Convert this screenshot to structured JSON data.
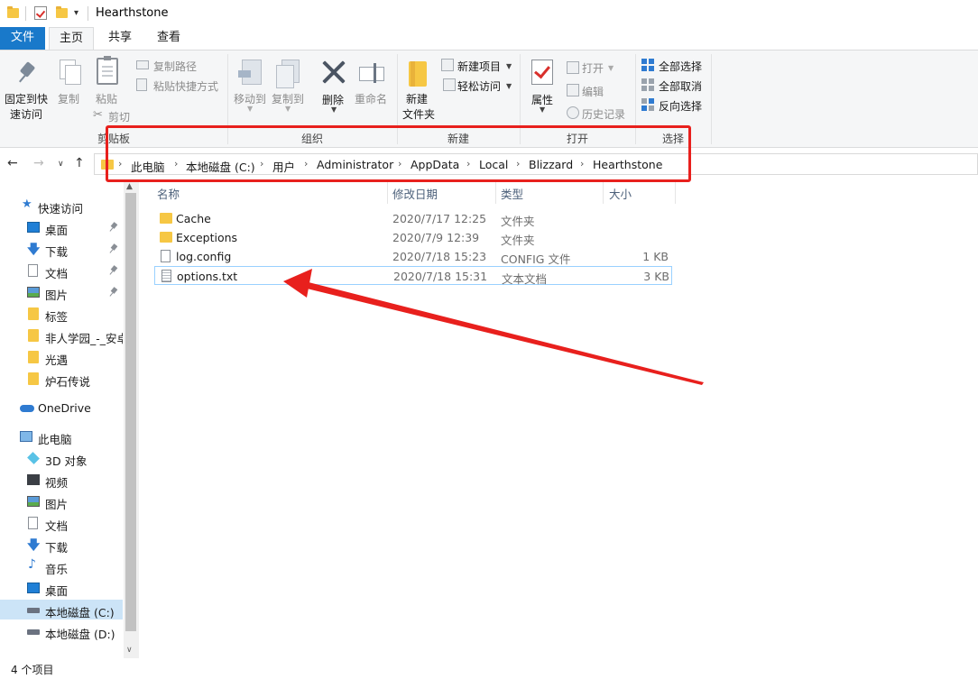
{
  "window": {
    "title": "Hearthstone"
  },
  "ribbon_tabs": {
    "file": "文件",
    "home": "主页",
    "share": "共享",
    "view": "查看"
  },
  "ribbon": {
    "clipboard": {
      "pin_line1": "固定到快",
      "pin_line2": "速访问",
      "copy": "复制",
      "paste": "粘贴",
      "copy_path": "复制路径",
      "paste_shortcut": "粘贴快捷方式",
      "cut": "剪切",
      "group_label": "剪贴板"
    },
    "organize": {
      "move_to": "移动到",
      "copy_to": "复制到",
      "delete": "删除",
      "rename": "重命名",
      "group_label": "组织"
    },
    "new": {
      "new_item": "新建项目",
      "easy_access": "轻松访问",
      "new_folder_line1": "新建",
      "new_folder_line2": "文件夹",
      "group_label": "新建"
    },
    "open": {
      "properties": "属性",
      "open": "打开",
      "edit": "编辑",
      "history": "历史记录",
      "group_label": "打开"
    },
    "select": {
      "select_all": "全部选择",
      "select_none": "全部取消",
      "invert": "反向选择",
      "group_label": "选择"
    }
  },
  "breadcrumb": [
    "此电脑",
    "本地磁盘 (C:)",
    "用户",
    "Administrator",
    "AppData",
    "Local",
    "Blizzard",
    "Hearthstone"
  ],
  "sidebar": {
    "quick_access": "快速访问",
    "items": [
      {
        "label": "桌面",
        "icon": "desktop-icon",
        "pinned": true
      },
      {
        "label": "下载",
        "icon": "download-icon",
        "pinned": true
      },
      {
        "label": "文档",
        "icon": "document-icon",
        "pinned": true
      },
      {
        "label": "图片",
        "icon": "picture-icon",
        "pinned": true
      },
      {
        "label": "标签",
        "icon": "folder-icon",
        "pinned": false
      },
      {
        "label": "非人学园_-_安卓",
        "icon": "folder-icon",
        "pinned": false
      },
      {
        "label": "光遇",
        "icon": "folder-icon",
        "pinned": false
      },
      {
        "label": "炉石传说",
        "icon": "folder-icon",
        "pinned": false
      }
    ],
    "onedrive": "OneDrive",
    "this_pc": "此电脑",
    "pc_items": [
      {
        "label": "3D 对象",
        "icon": "3d-objects-icon"
      },
      {
        "label": "视频",
        "icon": "video-icon"
      },
      {
        "label": "图片",
        "icon": "picture-icon"
      },
      {
        "label": "文档",
        "icon": "document-icon"
      },
      {
        "label": "下载",
        "icon": "download-icon"
      },
      {
        "label": "音乐",
        "icon": "music-icon"
      },
      {
        "label": "桌面",
        "icon": "desktop-icon"
      },
      {
        "label": "本地磁盘 (C:)",
        "icon": "drive-icon",
        "selected": true
      },
      {
        "label": "本地磁盘 (D:)",
        "icon": "drive-icon"
      }
    ]
  },
  "columns": {
    "name": "名称",
    "date": "修改日期",
    "type": "类型",
    "size": "大小"
  },
  "files": [
    {
      "name": "Cache",
      "date": "2020/7/17 12:25",
      "type": "文件夹",
      "size": "",
      "icon": "folder-icon"
    },
    {
      "name": "Exceptions",
      "date": "2020/7/9 12:39",
      "type": "文件夹",
      "size": "",
      "icon": "folder-icon"
    },
    {
      "name": "log.config",
      "date": "2020/7/18 15:23",
      "type": "CONFIG 文件",
      "size": "1 KB",
      "icon": "file-icon"
    },
    {
      "name": "options.txt",
      "date": "2020/7/18 15:31",
      "type": "文本文档",
      "size": "3 KB",
      "icon": "text-file-icon"
    }
  ],
  "status": {
    "item_count": "4 个项目"
  },
  "colors": {
    "accent": "#1979ca",
    "annotation_red": "#e8201d",
    "folder": "#f6c744",
    "selection": "#cce4f7"
  }
}
